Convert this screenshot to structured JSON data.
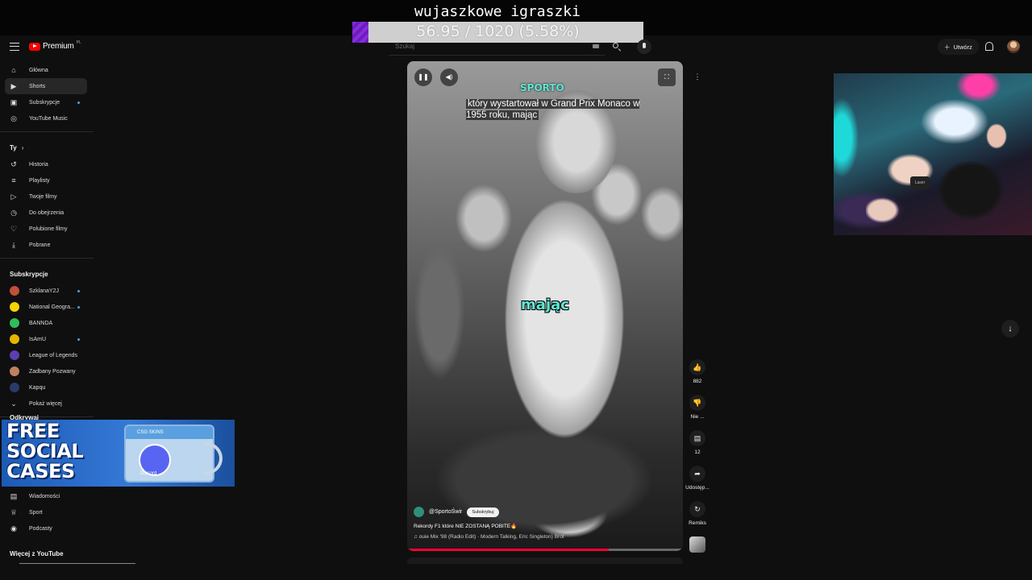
{
  "overlay": {
    "title": "wujaszkowe igraszki",
    "goal_text": "56.95 / 1020 (5.58%)",
    "goal_fraction": 0.0558
  },
  "header": {
    "logo_text": "Premium",
    "logo_region": "PL",
    "search_placeholder": "Szukaj",
    "create_label": "Utwórz"
  },
  "sidebar": {
    "main": [
      {
        "label": "Główna",
        "icon": "home-icon"
      },
      {
        "label": "Shorts",
        "icon": "shorts-icon",
        "active": true
      },
      {
        "label": "Subskrypcje",
        "icon": "subscriptions-icon",
        "dot": true
      },
      {
        "label": "YouTube Music",
        "icon": "music-icon"
      }
    ],
    "you_heading": "Ty",
    "you": [
      {
        "label": "Historia",
        "icon": "history-icon"
      },
      {
        "label": "Playlisty",
        "icon": "playlist-icon"
      },
      {
        "label": "Twoje filmy",
        "icon": "your-videos-icon"
      },
      {
        "label": "Do obejrzenia",
        "icon": "watch-later-icon"
      },
      {
        "label": "Polubione filmy",
        "icon": "like-icon"
      },
      {
        "label": "Pobrane",
        "icon": "download-icon"
      }
    ],
    "subs_heading": "Subskrypcje",
    "subs": [
      {
        "label": "SzklanaY2J",
        "color": "#c0503a",
        "dot": true
      },
      {
        "label": "National Geogra...",
        "color": "#f5d400",
        "dot": true
      },
      {
        "label": "BANNDA",
        "color": "#2fbf5a"
      },
      {
        "label": "IsAmU",
        "color": "#e6b400",
        "dot": true
      },
      {
        "label": "League of Legends",
        "color": "#5a3fb0"
      },
      {
        "label": "Zadbany Pozwany",
        "color": "#c08060"
      },
      {
        "label": "Kapqu",
        "color": "#2a3a6a"
      }
    ],
    "show_more": "Pokaż więcej",
    "explore_heading": "Odkrywaj",
    "explore": [
      {
        "label": "Wiadomości",
        "icon": "news-icon"
      },
      {
        "label": "Sport",
        "icon": "trophy-icon"
      },
      {
        "label": "Podcasty",
        "icon": "podcast-icon"
      }
    ],
    "more_heading": "Więcej z YouTube"
  },
  "ad": {
    "line1": "FREE",
    "line2": "SOCIAL",
    "line3": "CASES",
    "box_label": "CSG  SKINS",
    "discord": "Discord"
  },
  "short": {
    "watermark": "SPORTO",
    "subtitle": "który wystartował w Grand Prix Monaco w 1955 roku, mając",
    "caption_word": "mając",
    "channel": "@SportoŚwir",
    "subscribe_label": "Subskrybuj",
    "title": "Rekordy F1 które NIE ZOSTANĄ POBITE🔥",
    "music": "♫ ouie Mix '98 (Radio Edit) · Modern Talking, Eric Singleton)  Brot",
    "progress_fraction": 0.73
  },
  "actions": {
    "likes": "882",
    "dislike_label": "Nie ...",
    "comments": "12",
    "share_label": "Udostęp...",
    "remix_label": "Remiks"
  },
  "webcam": {
    "mic_brand": "Laser"
  }
}
